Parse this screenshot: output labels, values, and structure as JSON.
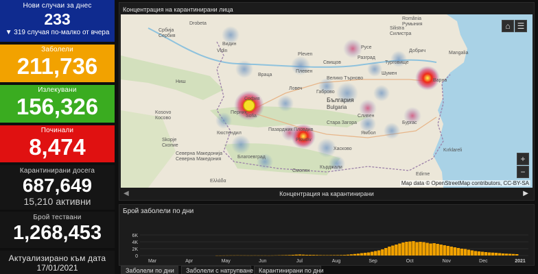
{
  "stats": {
    "new_today": {
      "label": "Нови случаи за днес",
      "value": "233",
      "sub": "▼ 319 случая по-малко от вчера"
    },
    "sick": {
      "label": "Заболели",
      "value": "211,736"
    },
    "recovered": {
      "label": "Излекувани",
      "value": "156,326"
    },
    "dead": {
      "label": "Починали",
      "value": "8,474"
    },
    "quarantined": {
      "label": "Карантинирани досега",
      "value": "687,649",
      "sub": "15,210 активни"
    },
    "tests": {
      "label": "Брой тествани",
      "value": "1,268,453"
    },
    "updated": {
      "label": "Актуализирано към дата",
      "date": "17/01/2021"
    }
  },
  "map": {
    "title": "Концентрация на карантинирани лица",
    "footer": "Концентрация на карантинирани",
    "attribution": "Map data © OpenStreetMap contributors, CC-BY-SA",
    "icons": {
      "home": "home-icon",
      "list": "list-icon",
      "zoom_in": "+",
      "zoom_out": "−",
      "prev": "◀",
      "next": "▶"
    },
    "labels": [
      "Србија",
      "Сербия",
      "România",
      "Румыния",
      "България",
      "Bulgaria",
      "София",
      "Sofia",
      "Пловдив",
      "Plovdiv",
      "Варна",
      "Бургас",
      "Кърджали",
      "Хасково",
      "Kosovo",
      "Косово",
      "Северна Македонија",
      "Северна Македония",
      "Ελλάδα",
      "Kırklareli",
      "Edirne",
      "Ниш",
      "Видин",
      "Враца",
      "Плевен",
      "Русе",
      "Ловеч",
      "Габрово",
      "Шумен",
      "Добрич",
      "Silistra",
      "Силистра",
      "Mangalia",
      "Стара Загора",
      "Ямбол",
      "Сливен",
      "Смолян",
      "Благоевград",
      "Пазарджик",
      "Кюстендил",
      "Перник",
      "Skopje",
      "Скопие",
      "Свищов",
      "Турговище",
      "Разград",
      "Велико Търново",
      "Pleven",
      "Drobeta",
      "Vidin"
    ],
    "colors": {
      "hotspot_core": "#f7e027",
      "hotspot_red": "#e81818",
      "hotspot_blue": "#7fa2c8"
    }
  },
  "chart": {
    "title": "Брой заболели по дни",
    "y_ticks": [
      "6K",
      "4K",
      "2K",
      "0"
    ],
    "x_ticks": [
      "Mar",
      "Apr",
      "May",
      "Jun",
      "Jul",
      "Aug",
      "Sep",
      "Oct",
      "Nov",
      "Dec",
      "2021"
    ]
  },
  "chart_data": {
    "type": "bar",
    "title": "Брой заболели по дни",
    "ylim": [
      0,
      6000
    ],
    "y_ticks": [
      0,
      2000,
      4000,
      6000
    ],
    "x_tick_labels": [
      "Mar",
      "Apr",
      "May",
      "Jun",
      "Jul",
      "Aug",
      "Sep",
      "Oct",
      "Nov",
      "Dec",
      "2021"
    ],
    "series": [
      {
        "values": [
          5,
          10,
          20,
          30,
          40,
          40,
          50,
          40,
          40,
          30,
          30,
          40,
          30,
          30,
          30,
          20,
          30,
          50,
          80,
          100,
          120,
          150,
          200,
          260,
          300,
          250,
          200,
          200,
          180,
          150,
          120,
          100,
          100,
          110,
          120,
          130,
          150,
          180,
          250,
          350,
          450,
          550,
          700,
          800,
          900,
          1100,
          1300,
          1500,
          1800,
          2200,
          2600,
          2900,
          3200,
          3500,
          3800,
          4000,
          4100,
          4200,
          3900,
          4000,
          3900,
          3700,
          3500,
          3600,
          3400,
          3200,
          3000,
          2800,
          2600,
          2400,
          2200,
          2000,
          1900,
          1700,
          1500,
          1300,
          1200,
          1100,
          1000,
          900,
          850,
          800,
          700,
          600,
          550,
          500,
          450,
          400
        ],
        "color": "#f2a200"
      }
    ],
    "grid": true
  },
  "tabs": [
    "Заболели по дни",
    "Заболели с натрупване",
    "Карантинирани по дни"
  ]
}
